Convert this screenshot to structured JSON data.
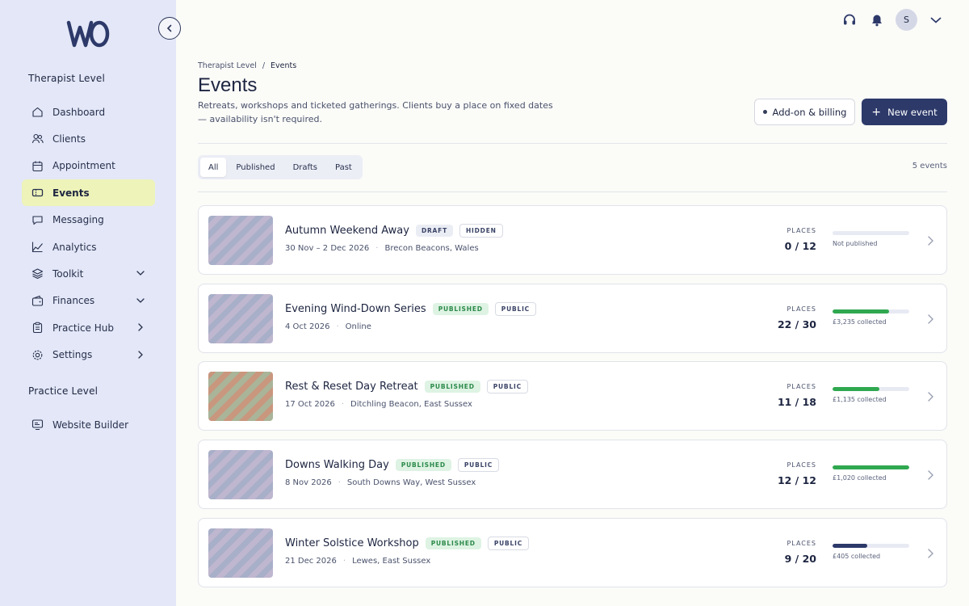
{
  "sidebar": {
    "logo_text": "wO",
    "therapist_section": "Therapist Level",
    "practice_section": "Practice Level",
    "items": [
      {
        "label": "Dashboard",
        "icon": "home-icon"
      },
      {
        "label": "Clients",
        "icon": "users-icon"
      },
      {
        "label": "Appointment",
        "icon": "calendar-icon"
      },
      {
        "label": "Events",
        "icon": "ticket-icon",
        "active": true
      },
      {
        "label": "Messaging",
        "icon": "chat-icon"
      },
      {
        "label": "Analytics",
        "icon": "chart-icon"
      },
      {
        "label": "Toolkit",
        "icon": "layers-icon",
        "expand": "chevron-down"
      },
      {
        "label": "Finances",
        "icon": "wallet-icon",
        "expand": "chevron-down"
      },
      {
        "label": "Practice Hub",
        "icon": "clipboard-icon",
        "expand": "chevron-right"
      },
      {
        "label": "Settings",
        "icon": "gear-icon",
        "expand": "chevron-right"
      }
    ],
    "practice_items": [
      {
        "label": "Website Builder",
        "icon": "monitor-icon"
      }
    ]
  },
  "topbar": {
    "avatar_initial": "S"
  },
  "header": {
    "breadcrumb": [
      "Therapist Level",
      "Events"
    ],
    "title": "Events",
    "description": "Retreats, workshops and ticketed gatherings. Clients buy a place on fixed dates — availability isn't required.",
    "addon_button": "Add-on & billing",
    "new_button": "New event"
  },
  "filters": {
    "tabs": [
      "All",
      "Published",
      "Drafts",
      "Past"
    ],
    "active": "All",
    "count": "5 events"
  },
  "events": [
    {
      "title": "Autumn Weekend Away",
      "badges": [
        "DRAFT",
        "HIDDEN"
      ],
      "date": "30 Nov – 2 Dec 2026",
      "location": "Brecon Beacons, Wales",
      "places_label": "PLACES",
      "places": "0 / 12",
      "fill": 0,
      "caption": "Not published",
      "thumb": "blue"
    },
    {
      "title": "Evening Wind-Down Series",
      "badges": [
        "PUBLISHED",
        "PUBLIC"
      ],
      "date": "4 Oct 2026",
      "location": "Online",
      "places_label": "PLACES",
      "places": "22 / 30",
      "fill": 0.733,
      "caption": "£3,235 collected",
      "thumb": "blue"
    },
    {
      "title": "Rest & Reset Day Retreat",
      "badges": [
        "PUBLISHED",
        "PUBLIC"
      ],
      "date": "17 Oct 2026",
      "location": "Ditchling Beacon, East Sussex",
      "places_label": "PLACES",
      "places": "11 / 18",
      "fill": 0.611,
      "caption": "£1,135 collected",
      "thumb": "warm"
    },
    {
      "title": "Downs Walking Day",
      "badges": [
        "PUBLISHED",
        "PUBLIC"
      ],
      "date": "8 Nov 2026",
      "location": "South Downs Way, West Sussex",
      "places_label": "PLACES",
      "places": "12 / 12",
      "fill": 1.0,
      "caption": "£1,020 collected",
      "thumb": "blue"
    },
    {
      "title": "Winter Solstice Workshop",
      "badges": [
        "PUBLISHED",
        "PUBLIC"
      ],
      "date": "21 Dec 2026",
      "location": "Lewes, East Sussex",
      "places_label": "PLACES",
      "places": "9 / 20",
      "fill": 0.45,
      "caption": "£405 collected",
      "thumb": "blue"
    }
  ],
  "colors": {
    "sidebar_bg": "#e3e7f7",
    "active_nav": "#eef3b9",
    "primary": "#2c3969",
    "bar_green": "#2fa84f",
    "bar_navy": "#2c3969",
    "badge_published_bg": "#def3e3"
  }
}
